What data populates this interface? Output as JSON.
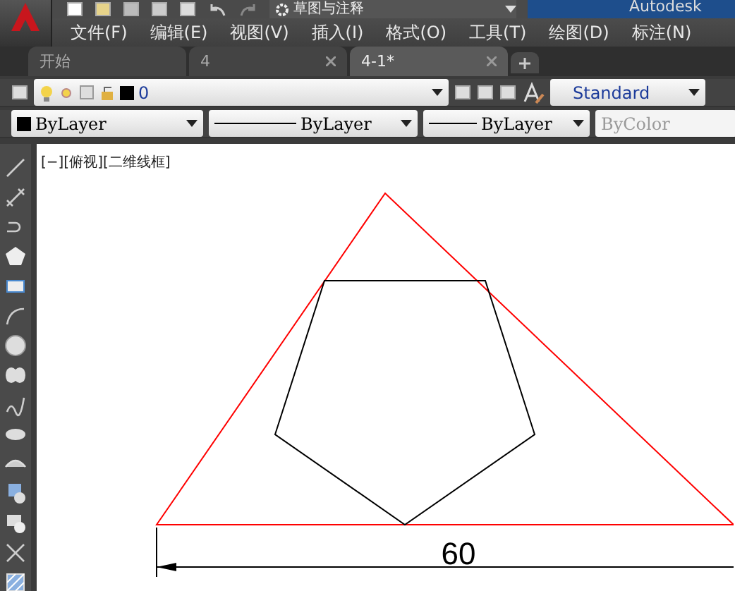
{
  "title_bar": {
    "workspace": "草图与注释",
    "app_name": "Autodesk"
  },
  "menu": [
    "文件(F)",
    "编辑(E)",
    "视图(V)",
    "插入(I)",
    "格式(O)",
    "工具(T)",
    "绘图(D)",
    "标注(N)"
  ],
  "tabs": [
    {
      "label": "开始",
      "selected": false,
      "closable": false
    },
    {
      "label": "4",
      "selected": false,
      "closable": true
    },
    {
      "label": "4-1*",
      "selected": true,
      "closable": true
    }
  ],
  "layer_toolbar": {
    "layer": "0",
    "text_style": "Standard"
  },
  "properties_toolbar": {
    "color_setting": "ByLayer",
    "linetype": "ByLayer",
    "lineweight": "ByLayer",
    "plot_style": {
      "value": "ByColor",
      "disabled": true
    }
  },
  "draw_tools": [
    {
      "kind": "line"
    },
    {
      "kind": "xline"
    },
    {
      "kind": "polyline"
    },
    {
      "kind": "polygon"
    },
    {
      "kind": "rectangle"
    },
    {
      "kind": "arc"
    },
    {
      "kind": "circle"
    },
    {
      "kind": "cloud"
    },
    {
      "kind": "spline"
    },
    {
      "kind": "ellipse"
    },
    {
      "kind": "ellipse-arc"
    },
    {
      "kind": "insert"
    },
    {
      "kind": "block"
    },
    {
      "kind": "point"
    },
    {
      "kind": "hatch"
    }
  ],
  "viewport": {
    "label": "[−][俯视][二维线框]",
    "dimension": "60"
  }
}
